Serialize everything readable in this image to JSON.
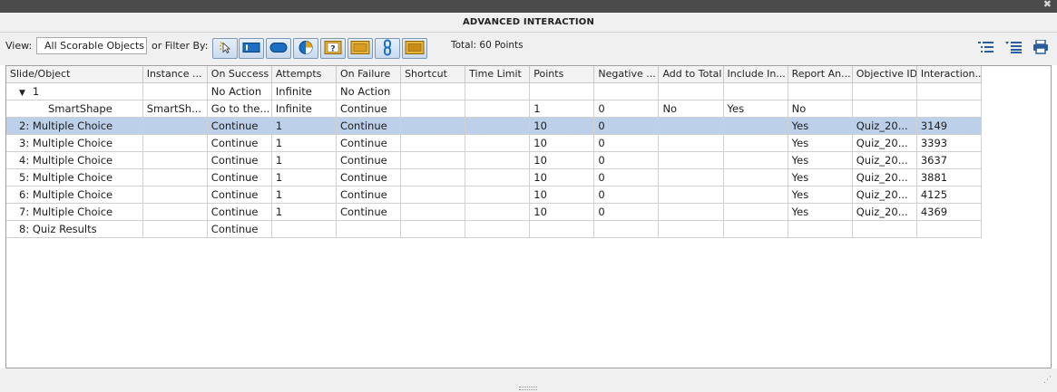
{
  "window": {
    "title": "ADVANCED INTERACTION",
    "close_glyph": "✖"
  },
  "toolbar": {
    "view_label": "View:",
    "view_value": "All Scorable Objects",
    "filter_label": "or Filter By:",
    "total": "Total: 60 Points",
    "filters": [
      {
        "icon": "click-box-icon"
      },
      {
        "icon": "text-entry-box-icon"
      },
      {
        "icon": "button-icon"
      },
      {
        "icon": "smart-shape-icon"
      },
      {
        "icon": "question-slide-icon"
      },
      {
        "icon": "drag-drop-icon"
      },
      {
        "icon": "hyperlink-icon"
      },
      {
        "icon": "interaction-widget-icon"
      }
    ],
    "right_icons": [
      "expand-list-icon",
      "collapse-list-icon",
      "print-icon"
    ]
  },
  "table": {
    "headers": [
      "Slide/Object",
      "Instance ...",
      "On Success",
      "Attempts",
      "On Failure",
      "Shortcut",
      "Time Limit",
      "Points",
      "Negative ...",
      "Add to Total",
      "Include In...",
      "Report An...",
      "Objective ID",
      "Interaction..."
    ],
    "rows": [
      {
        "cells": [
          "1",
          "",
          "No Action",
          "Infinite",
          "No Action",
          "",
          "",
          "",
          "",
          "",
          "",
          "",
          "",
          ""
        ]
      },
      {
        "cells": [
          "SmartShape",
          "SmartSh...",
          "Go to the...",
          "Infinite",
          "Continue",
          "",
          "",
          "1",
          "0",
          "No",
          "Yes",
          "No",
          "",
          ""
        ]
      },
      {
        "cells": [
          "2: Multiple Choice",
          "",
          "Continue",
          "1",
          "Continue",
          "",
          "",
          "10",
          "0",
          "",
          "",
          "Yes",
          "Quiz_20...",
          "3149"
        ]
      },
      {
        "cells": [
          "3: Multiple Choice",
          "",
          "Continue",
          "1",
          "Continue",
          "",
          "",
          "10",
          "0",
          "",
          "",
          "Yes",
          "Quiz_20...",
          "3393"
        ]
      },
      {
        "cells": [
          "4: Multiple Choice",
          "",
          "Continue",
          "1",
          "Continue",
          "",
          "",
          "10",
          "0",
          "",
          "",
          "Yes",
          "Quiz_20...",
          "3637"
        ]
      },
      {
        "cells": [
          "5: Multiple Choice",
          "",
          "Continue",
          "1",
          "Continue",
          "",
          "",
          "10",
          "0",
          "",
          "",
          "Yes",
          "Quiz_20...",
          "3881"
        ]
      },
      {
        "cells": [
          "6: Multiple Choice",
          "",
          "Continue",
          "1",
          "Continue",
          "",
          "",
          "10",
          "0",
          "",
          "",
          "Yes",
          "Quiz_20...",
          "4125"
        ]
      },
      {
        "cells": [
          "7: Multiple Choice",
          "",
          "Continue",
          "1",
          "Continue",
          "",
          "",
          "10",
          "0",
          "",
          "",
          "Yes",
          "Quiz_20...",
          "4369"
        ]
      },
      {
        "cells": [
          "8: Quiz Results",
          "",
          "Continue",
          "",
          "",
          "",
          "",
          "",
          "",
          "",
          "",
          "",
          "",
          ""
        ]
      }
    ]
  },
  "colors": {
    "selected_row": "#bcd0ea",
    "accent": "#2a5d9c"
  }
}
